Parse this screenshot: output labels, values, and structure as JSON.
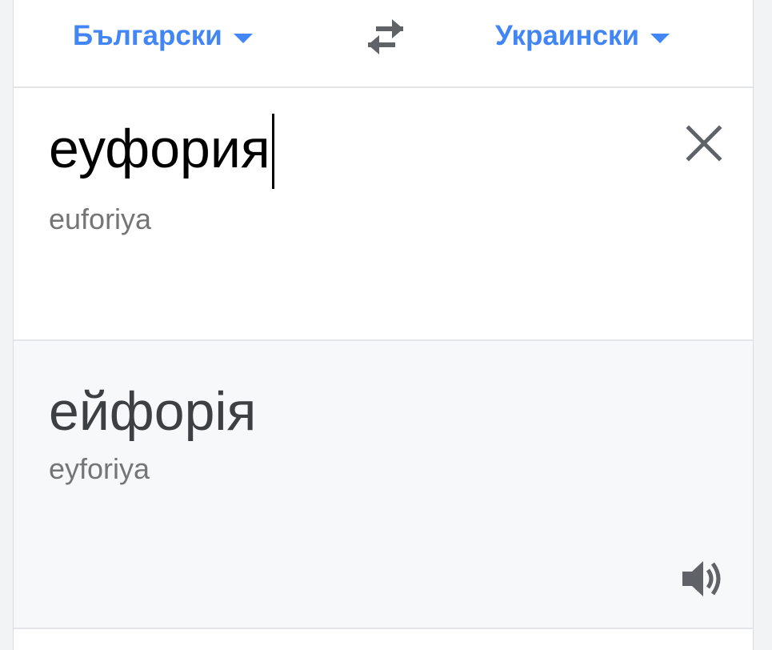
{
  "language_bar": {
    "source_language": "Български",
    "target_language": "Украински"
  },
  "input": {
    "text": "еуфория",
    "transliteration": "euforiya"
  },
  "output": {
    "text": "ейфорія",
    "transliteration": "eyforiya"
  },
  "icons": {
    "source_dropdown": "chevron-down-icon",
    "target_dropdown": "chevron-down-icon",
    "swap": "swap-arrows-icon",
    "clear": "close-icon",
    "speaker": "speaker-icon"
  },
  "colors": {
    "accent": "#4285f4",
    "icon_gray": "#5f6368",
    "output_background": "#f7f8fa"
  }
}
